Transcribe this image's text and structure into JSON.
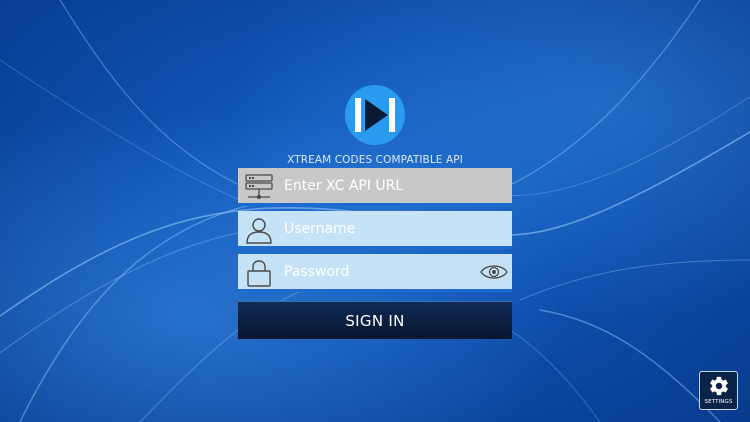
{
  "header": {
    "api_label": "XTREAM CODES COMPATIBLE API"
  },
  "form": {
    "url_placeholder": "Enter XC API URL",
    "username_placeholder": "Username",
    "password_placeholder": "Password",
    "signin_label": "SIGN IN"
  },
  "footer": {
    "settings_label": "SETTINGS"
  },
  "icons": {
    "logo": "play-logo-icon",
    "url": "server-icon",
    "username": "user-icon",
    "password": "lock-icon",
    "reveal": "eye-icon",
    "settings": "gear-icon"
  },
  "colors": {
    "background": "#0e4fae",
    "logo_blue": "#2a9bf0",
    "url_field": "#c8c8c8",
    "input_field": "#c5e2f7",
    "field_underline": "#1d6bd0",
    "signin_button": "#0b1f40"
  }
}
